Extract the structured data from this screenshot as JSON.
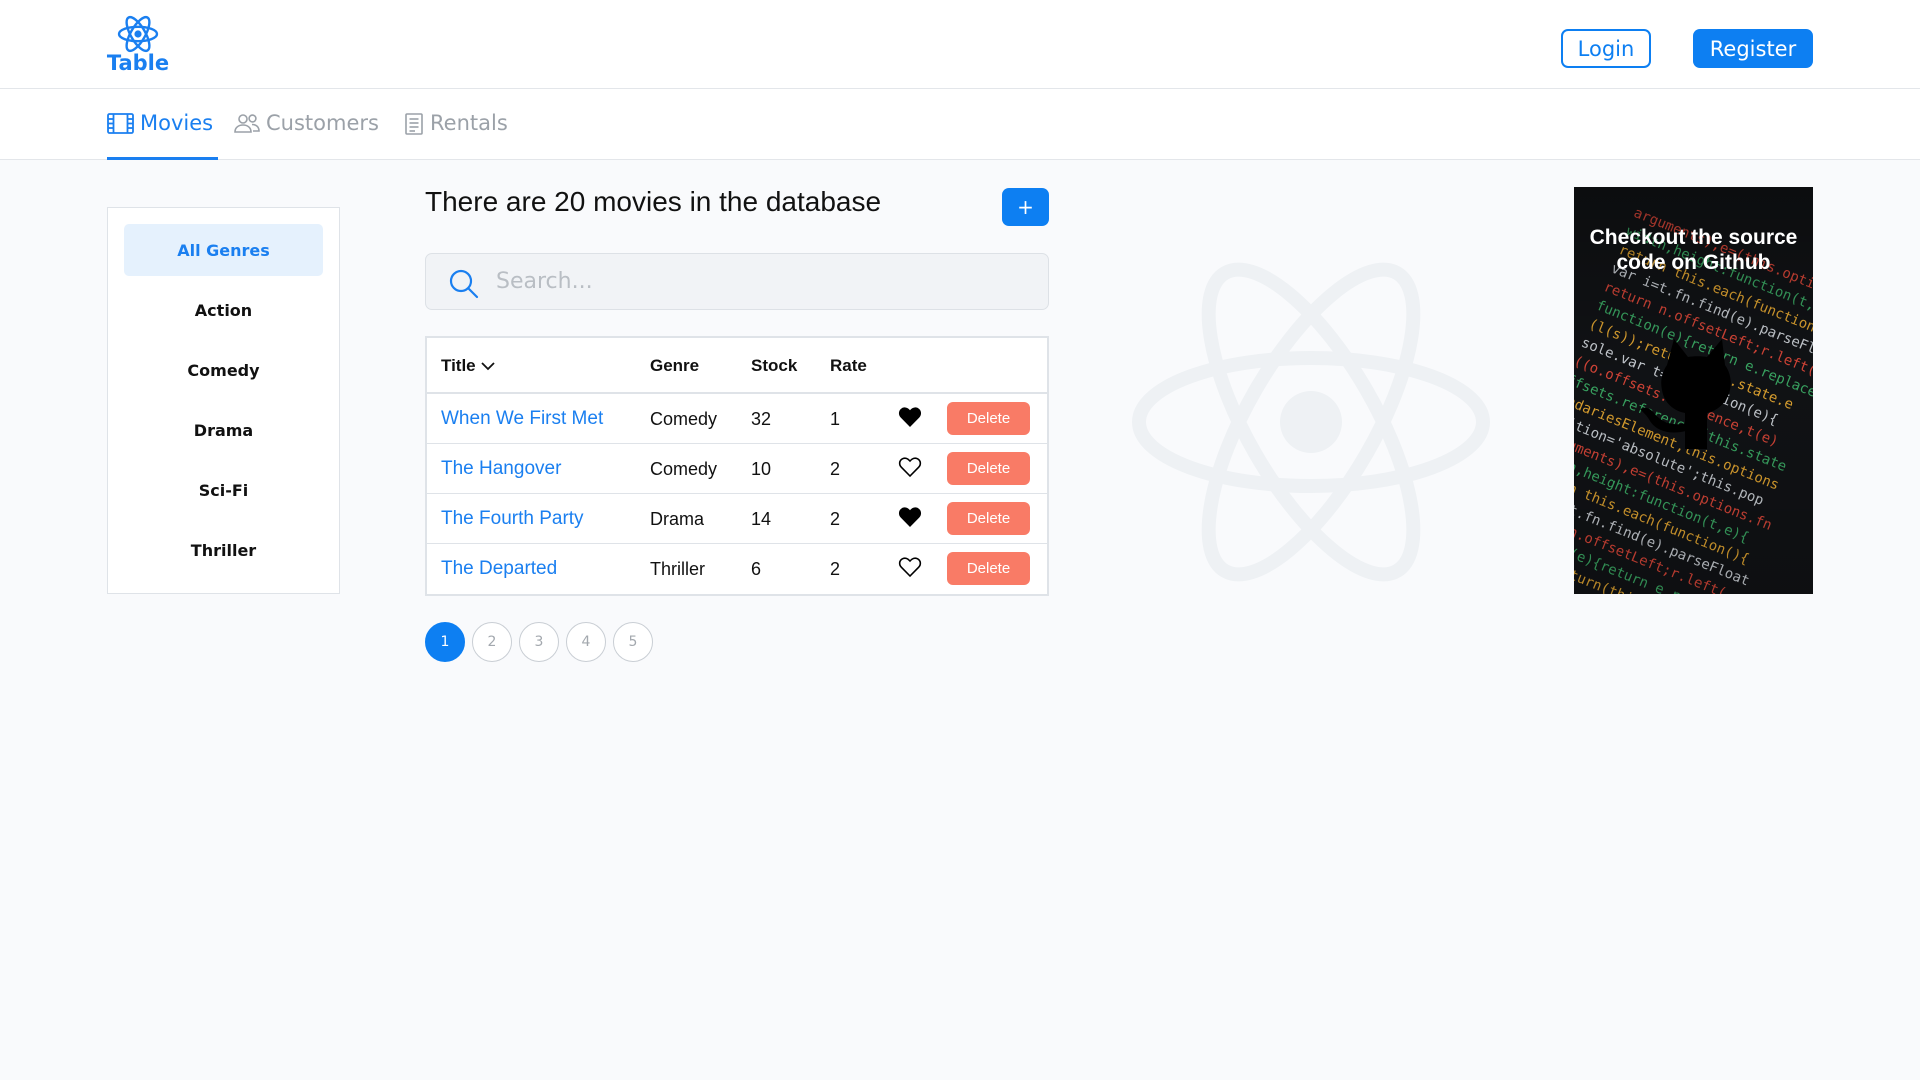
{
  "header": {
    "logo_text": "Table",
    "login_label": "Login",
    "register_label": "Register"
  },
  "tabs": [
    {
      "label": "Movies",
      "icon": "film-icon",
      "active": true
    },
    {
      "label": "Customers",
      "icon": "users-icon",
      "active": false
    },
    {
      "label": "Rentals",
      "icon": "document-icon",
      "active": false
    }
  ],
  "genres": [
    "All Genres",
    "Action",
    "Comedy",
    "Drama",
    "Sci-Fi",
    "Thriller"
  ],
  "main": {
    "heading": "There are 20 movies in the database",
    "add_label": "+",
    "search_placeholder": "Search..."
  },
  "table": {
    "columns": [
      "Title",
      "Genre",
      "Stock",
      "Rate"
    ],
    "sort_icon": "chevron-down-icon",
    "delete_label": "Delete",
    "rows": [
      {
        "title": "When We First Met",
        "genre": "Comedy",
        "stock": "32",
        "rate": "1",
        "liked": true
      },
      {
        "title": "The Hangover",
        "genre": "Comedy",
        "stock": "10",
        "rate": "2",
        "liked": false
      },
      {
        "title": "The Fourth Party",
        "genre": "Drama",
        "stock": "14",
        "rate": "2",
        "liked": true
      },
      {
        "title": "The Departed",
        "genre": "Thriller",
        "stock": "6",
        "rate": "2",
        "liked": false
      }
    ]
  },
  "pagination": {
    "pages": [
      "1",
      "2",
      "3",
      "4",
      "5"
    ],
    "current": "1"
  },
  "github_card": {
    "line1": "Checkout the source",
    "line2": "code on Github",
    "icon": "github-octocat-icon"
  },
  "colors": {
    "accent": "#0d7ff2",
    "delete": "#f97b66",
    "active_genre_bg": "#e5f1fd"
  }
}
